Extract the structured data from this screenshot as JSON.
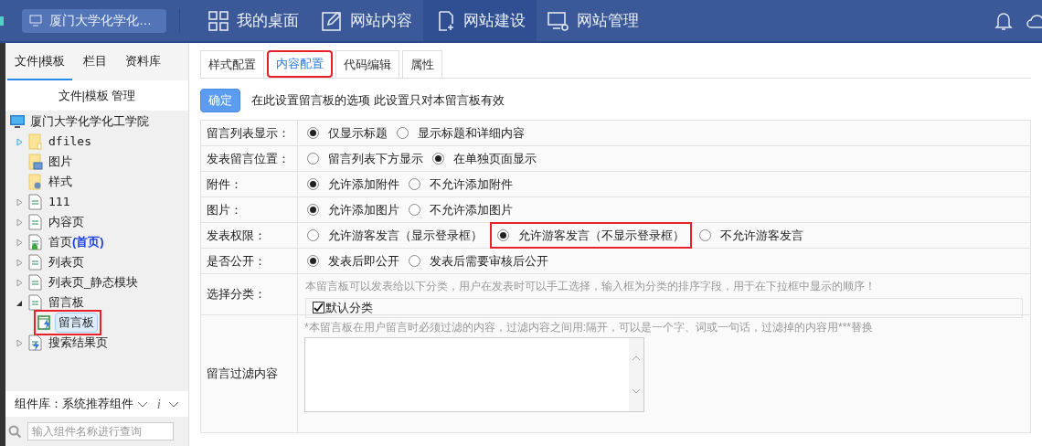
{
  "topbar": {
    "site_selector": "厦门大学化学化…",
    "nav": [
      {
        "label": "我的桌面",
        "selected": false
      },
      {
        "label": "网站内容",
        "selected": false
      },
      {
        "label": "网站建设",
        "selected": true
      },
      {
        "label": "网站管理",
        "selected": false
      }
    ]
  },
  "sidebar": {
    "tabs": [
      {
        "label": "文件|模板",
        "selected": true
      },
      {
        "label": "栏目",
        "selected": false
      },
      {
        "label": "资料库",
        "selected": false
      }
    ],
    "heading": "文件|模板 管理",
    "tree": {
      "label": "厦门大学化学化工学院",
      "children": [
        {
          "label": "dfiles",
          "expanded": false,
          "selected": false
        },
        {
          "label": "图片",
          "selected": false
        },
        {
          "label": "样式",
          "selected": false
        },
        {
          "label": "111",
          "expanded": false,
          "selected": false
        },
        {
          "label": "内容页",
          "expanded": false,
          "selected": false
        },
        {
          "label": "首页",
          "tag": "(首页)",
          "expanded": false,
          "selected": false
        },
        {
          "label": "列表页",
          "expanded": false,
          "selected": false
        },
        {
          "label": "列表页_静态模块",
          "expanded": false,
          "selected": false
        },
        {
          "label": "留言板",
          "expanded": true,
          "selected": false,
          "children": [
            {
              "label": "留言板",
              "selected": true,
              "highlighted": true
            }
          ]
        },
        {
          "label": "搜索结果页",
          "expanded": false,
          "selected": false
        }
      ]
    },
    "library": {
      "label": "组件库：系统推荐组件",
      "info": "i"
    },
    "search": {
      "placeholder": "输入组件名称进行查询"
    }
  },
  "main": {
    "tabs": [
      {
        "label": "样式配置",
        "selected": false,
        "highlighted": false
      },
      {
        "label": "内容配置",
        "selected": true,
        "highlighted": true
      },
      {
        "label": "代码编辑",
        "selected": false,
        "highlighted": false
      },
      {
        "label": "属性",
        "selected": false,
        "highlighted": false
      }
    ],
    "confirm": "确定",
    "hint": "在此设置留言板的选项 此设置只对本留言板有效",
    "rows": [
      {
        "kind": "radio",
        "label": "留言列表显示：",
        "options": [
          {
            "label": "仅显示标题",
            "selected": true,
            "highlighted": false
          },
          {
            "label": "显示标题和详细内容",
            "selected": false,
            "highlighted": false
          }
        ]
      },
      {
        "kind": "radio",
        "label": "发表留言位置：",
        "options": [
          {
            "label": "留言列表下方显示",
            "selected": false,
            "highlighted": false
          },
          {
            "label": "在单独页面显示",
            "selected": true,
            "highlighted": false
          }
        ]
      },
      {
        "kind": "radio",
        "label": "附件：",
        "options": [
          {
            "label": "允许添加附件",
            "selected": true,
            "highlighted": false
          },
          {
            "label": "不允许添加附件",
            "selected": false,
            "highlighted": false
          }
        ]
      },
      {
        "kind": "radio",
        "label": "图片：",
        "options": [
          {
            "label": "允许添加图片",
            "selected": true,
            "highlighted": false
          },
          {
            "label": "不允许添加图片",
            "selected": false,
            "highlighted": false
          }
        ]
      },
      {
        "kind": "radio",
        "label": "发表权限：",
        "options": [
          {
            "label": "允许游客发言（显示登录框）",
            "selected": false,
            "highlighted": false
          },
          {
            "label": "允许游客发言（不显示登录框）",
            "selected": true,
            "highlighted": true
          },
          {
            "label": "不允许游客发言",
            "selected": false,
            "highlighted": false
          }
        ]
      },
      {
        "kind": "radio",
        "label": "是否公开：",
        "options": [
          {
            "label": "发表后即公开",
            "selected": true,
            "highlighted": false
          },
          {
            "label": "发表后需要审核后公开",
            "selected": false,
            "highlighted": false
          }
        ]
      },
      {
        "kind": "category",
        "label": "选择分类：",
        "note": "本留言板可以发表给以下分类，用户在发表时可以手工选择，输入框为分类的排序字段，用于在下拉框中显示的顺序！",
        "items": [
          {
            "label": "默认分类",
            "checked": true
          }
        ]
      },
      {
        "kind": "textarea",
        "label": "留言过滤内容",
        "note": "*本留言板在用户留言时必须过滤的内容，过滤内容之间用:隔开，可以是一个字、词或一句话，过滤掉的内容用***替换"
      }
    ]
  }
}
